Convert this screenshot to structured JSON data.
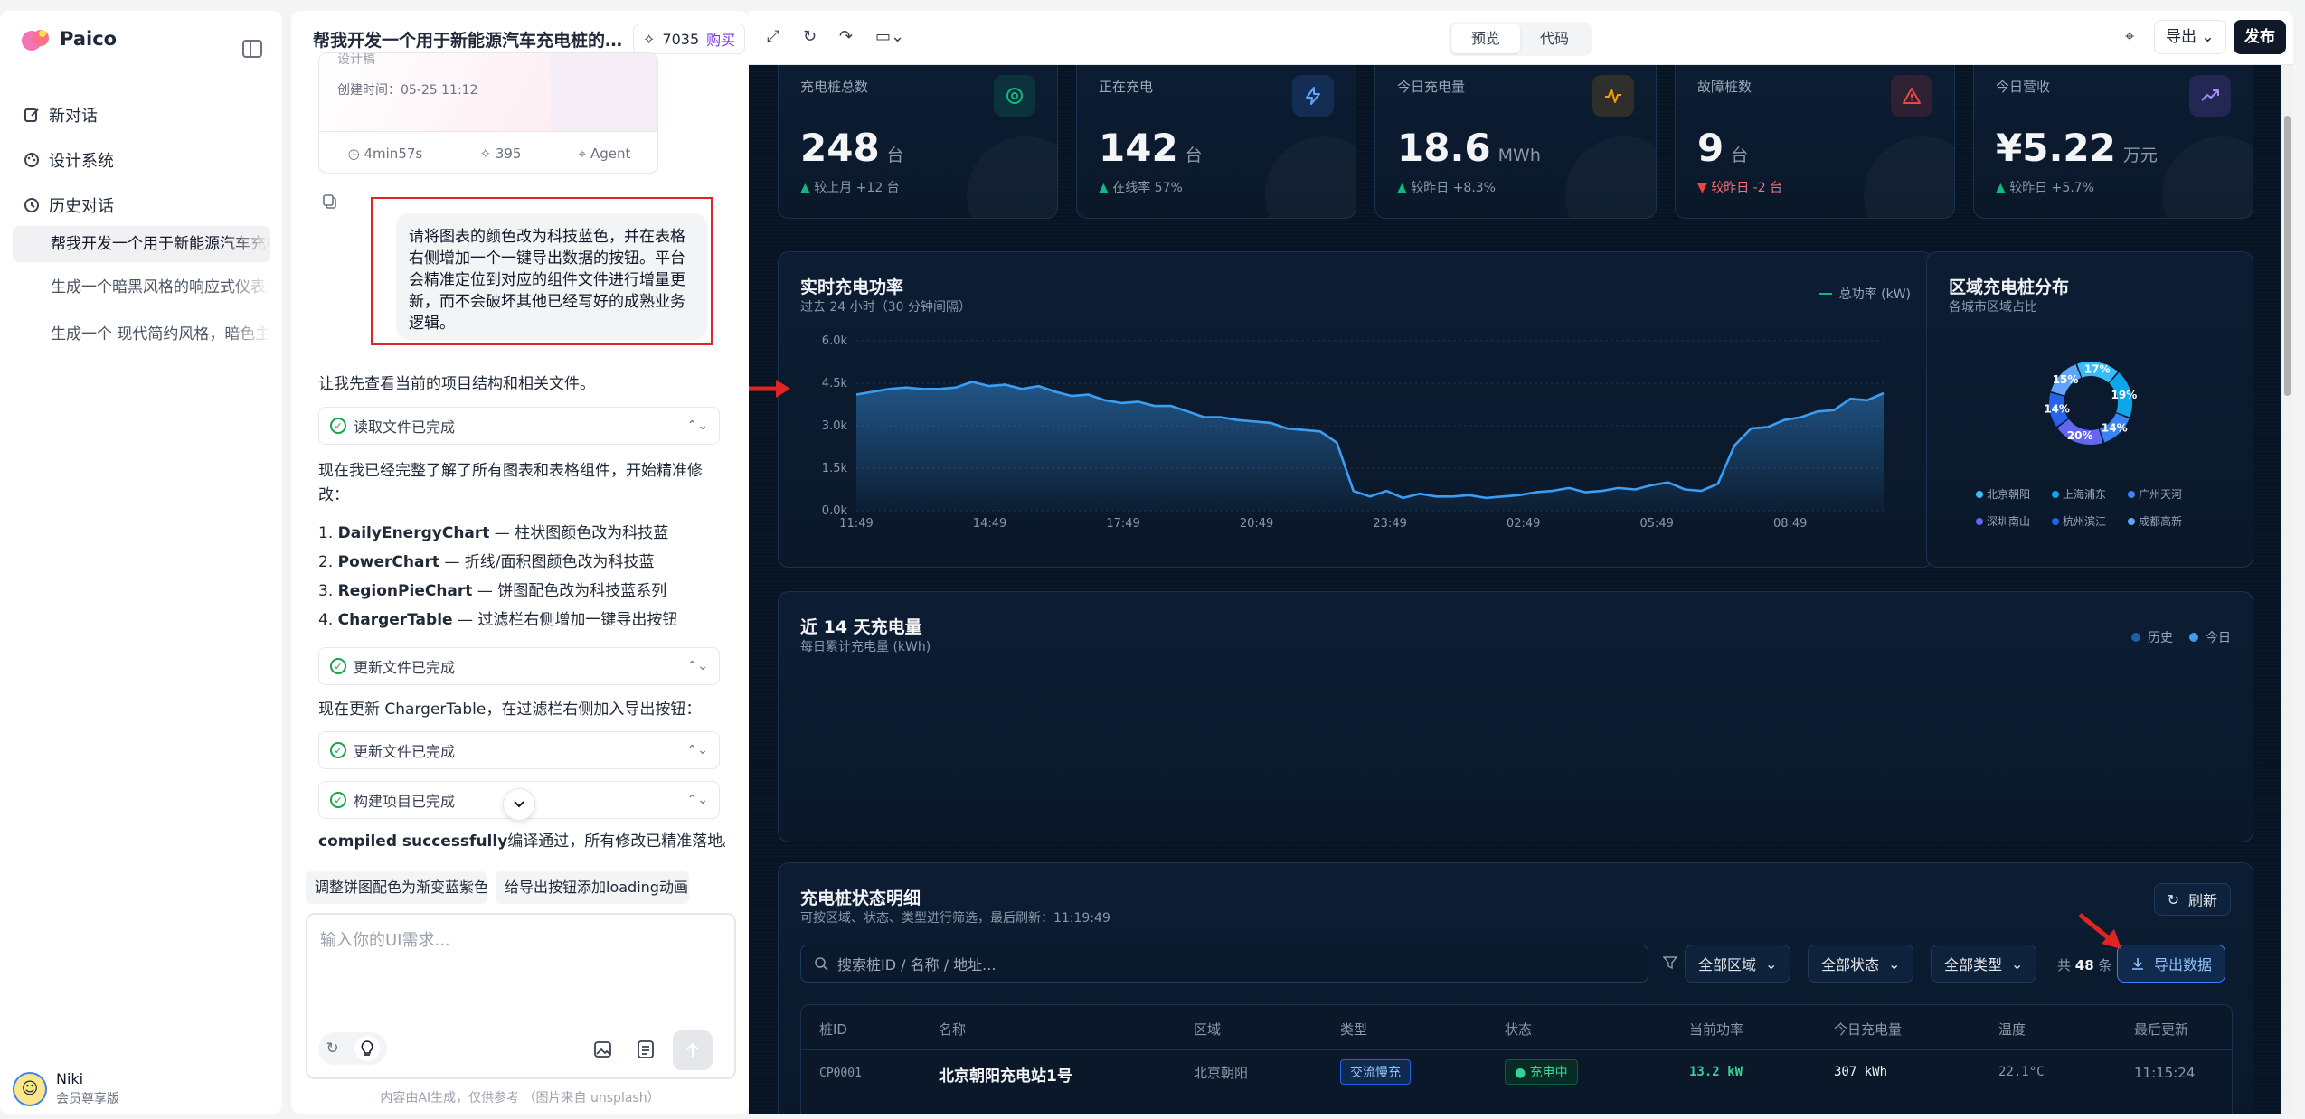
{
  "app": {
    "name": "Paico"
  },
  "sidebar": {
    "nav": [
      {
        "label": "新对话",
        "icon": "edit-icon"
      },
      {
        "label": "设计系统",
        "icon": "palette-icon"
      },
      {
        "label": "历史对话",
        "icon": "history-icon"
      }
    ],
    "history": [
      "帮我开发一个用于新能源汽车充电桩的数据",
      "生成一个暗黑风格的响应式仪表盘",
      "生成一个 现代简约风格，暗色主题"
    ],
    "user": {
      "name": "Niki",
      "plan": "会员尊享版"
    }
  },
  "chat": {
    "title": "帮我开发一个用于新能源汽车充电桩的数...",
    "credits": "7035",
    "buy_label": "购买",
    "card": {
      "label": "设计稿",
      "created": "创建时间：05-25 11:12",
      "duration": "4min57s",
      "points": "395",
      "mode": "Agent"
    },
    "user_message": "请将图表的颜色改为科技蓝色，并在表格右侧增加一个一键导出数据的按钮。平台会精准定位到对应的组件文件进行增量更新，而不会破坏其他已经写好的成熟业务逻辑。",
    "reply1": "让我先查看当前的项目结构和相关文件。",
    "status_read": "读取文件已完成",
    "reply2": "现在我已经完整了解了所有图表和表格组件，开始精准修改：",
    "list": [
      {
        "num": "1.",
        "name": "DailyEnergyChart",
        "desc": " — 柱状图颜色改为科技蓝"
      },
      {
        "num": "2.",
        "name": "PowerChart",
        "desc": " — 折线/面积图颜色改为科技蓝"
      },
      {
        "num": "3.",
        "name": "RegionPieChart",
        "desc": " — 饼图配色改为科技蓝系列"
      },
      {
        "num": "4.",
        "name": "ChargerTable",
        "desc": " — 过滤栏右侧增加一键导出按钮"
      }
    ],
    "status_update": "更新文件已完成",
    "reply3": "现在更新 ChargerTable，在过滤栏右侧加入导出按钮：",
    "status_update2": "更新文件已完成",
    "status_build": "构建项目已完成",
    "reply4_bold": "compiled successfully",
    "reply4": "编译通过，所有修改已精准落地。",
    "chips": [
      "调整饼图配色为渐变蓝紫色",
      "给导出按钮添加loading动画"
    ],
    "input_placeholder": "输入你的UI需求...",
    "footnote": "内容由AI生成，仅供参考 （图片来自 unsplash）"
  },
  "toolbar": {
    "tabs": [
      "预览",
      "代码"
    ],
    "active_tab": "预览",
    "export_label": "导出",
    "publish_label": "发布"
  },
  "kpis": [
    {
      "label": "充电桩总数",
      "value": "248",
      "unit": "台",
      "delta": "▲ 较上月 +12 台",
      "trend": "up",
      "icon": "target-icon",
      "color": "#10b981"
    },
    {
      "label": "正在充电",
      "value": "142",
      "unit": "台",
      "delta": "▲ 在线率 57%",
      "trend": "up",
      "icon": "bolt-icon",
      "color": "#3b82f6"
    },
    {
      "label": "今日充电量",
      "value": "18.6",
      "unit": "MWh",
      "delta": "▲ 较昨日 +8.3%",
      "trend": "up",
      "icon": "pulse-icon",
      "color": "#f59e0b"
    },
    {
      "label": "故障桩数",
      "value": "9",
      "unit": "台",
      "delta": "▼ 较昨日 -2 台",
      "trend": "down",
      "icon": "warning-icon",
      "color": "#ef4444"
    },
    {
      "label": "今日营收",
      "value": "¥5.22",
      "unit": "万元",
      "delta": "▲ 较昨日 +5.7%",
      "trend": "up",
      "icon": "trend-icon",
      "color": "#8b5cf6"
    }
  ],
  "power_panel": {
    "title": "实时充电功率",
    "subtitle": "过去 24 小时（30 分钟间隔）"
  },
  "region_panel": {
    "title": "区域充电桩分布",
    "subtitle": "各城市区域占比"
  },
  "energy_panel": {
    "title": "近 14 天充电量",
    "subtitle": "每日累计充电量 (kWh)",
    "legend": [
      "历史",
      "今日"
    ]
  },
  "table_panel": {
    "title": "充电桩状态明细",
    "subtitle": "可按区域、状态、类型进行筛选，最后刷新：11:19:49",
    "refresh_label": "刷新",
    "search_placeholder": "搜索桩ID / 名称 / 地址...",
    "filters": [
      "全部区域",
      "全部状态",
      "全部类型"
    ],
    "count_prefix": "共",
    "count": "48",
    "count_suffix": "条",
    "export_label": "导出数据",
    "columns": [
      "桩ID",
      "名称",
      "区域",
      "类型",
      "状态",
      "当前功率",
      "今日充电量",
      "温度",
      "最后更新"
    ],
    "rows": [
      {
        "id": "CP0001",
        "name": "北京朝阳充电站1号",
        "region": "北京朝阳",
        "type": "交流慢充",
        "status": "充电中",
        "power": "13.2 kW",
        "energy": "307 kWh",
        "temp": "22.1°C",
        "updated": "11:15:24"
      }
    ]
  },
  "chart_data": [
    {
      "type": "area",
      "series": [
        {
          "name": "总功率 (kW)",
          "color": "#3b9ef5",
          "values": [
            4100,
            4200,
            4300,
            4350,
            4300,
            4300,
            4350,
            4550,
            4400,
            4450,
            4300,
            4400,
            4200,
            4050,
            4100,
            3900,
            3800,
            3850,
            3700,
            3700,
            3500,
            3300,
            3300,
            3200,
            3150,
            3100,
            2900,
            2850,
            2800,
            2400,
            700,
            500,
            700,
            450,
            600,
            500,
            500,
            550,
            450,
            500,
            550,
            650,
            700,
            800,
            650,
            700,
            800,
            750,
            900,
            1000,
            750,
            700,
            950,
            2300,
            2900,
            2950,
            3200,
            3300,
            3500,
            3550,
            3950,
            3900,
            4150
          ]
        }
      ],
      "x_ticks": [
        "11:49",
        "14:49",
        "17:49",
        "20:49",
        "23:49",
        "02:49",
        "05:49",
        "08:49"
      ],
      "y_ticks": [
        "0.0k",
        "1.5k",
        "3.0k",
        "4.5k",
        "6.0k"
      ],
      "ylim": [
        0,
        6000
      ],
      "grid": true,
      "legend": "top-right"
    },
    {
      "type": "pie",
      "donut": true,
      "categories": [
        "北京朝阳",
        "上海浦东",
        "广州天河",
        "深圳南山",
        "杭州滨江",
        "成都高新"
      ],
      "values": [
        17,
        19,
        14,
        20,
        14,
        15
      ],
      "colors": [
        "#38bdf8",
        "#0ea5e9",
        "#3b82f6",
        "#6366f1",
        "#2563eb",
        "#60a5fa"
      ],
      "legend": "bottom"
    }
  ]
}
